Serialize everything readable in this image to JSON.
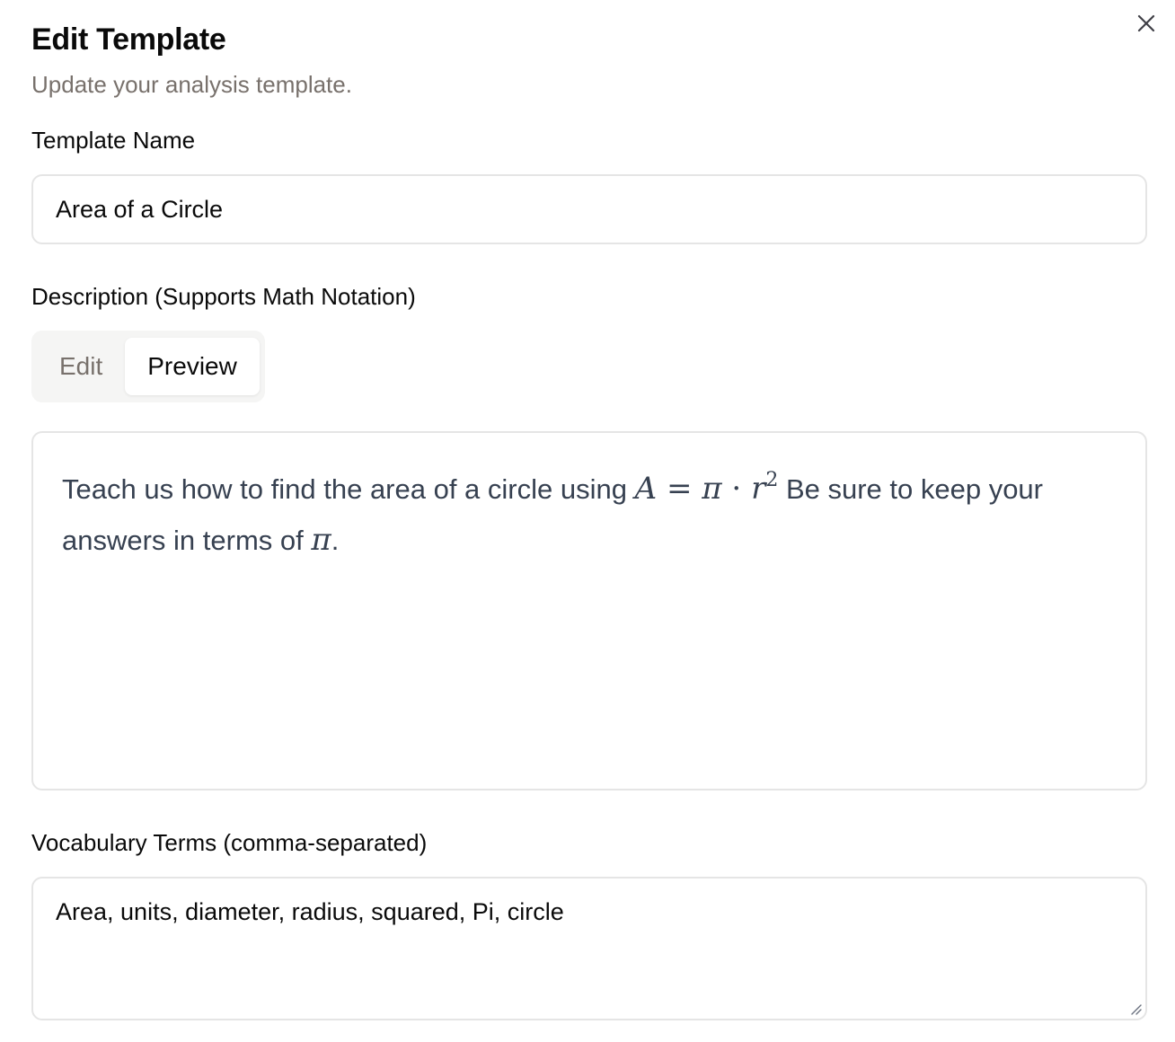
{
  "dialog": {
    "title": "Edit Template",
    "subtitle": "Update your analysis template.",
    "close_icon": "close-icon"
  },
  "template_name": {
    "label": "Template Name",
    "value": "Area of a Circle"
  },
  "description": {
    "label": "Description (Supports Math Notation)",
    "tabs": [
      {
        "label": "Edit",
        "active": false
      },
      {
        "label": "Preview",
        "active": true
      }
    ],
    "preview": {
      "text_before": "Teach us how to find the area of a circle using ",
      "math_A": "A",
      "math_eq": " = ",
      "math_pi": "π",
      "math_dot": " · ",
      "math_r": "r",
      "math_exp": "2",
      "text_middle": " Be sure to keep your answers in terms of ",
      "math_pi_end": "π",
      "text_end": "."
    }
  },
  "vocabulary": {
    "label": "Vocabulary Terms (comma-separated)",
    "value": "Area, units, diameter, radius, squared, Pi, circle"
  },
  "colors": {
    "muted_text": "#78716c",
    "border": "#e5e5e5",
    "tab_bg": "#f5f5f4",
    "preview_text": "#374151"
  }
}
